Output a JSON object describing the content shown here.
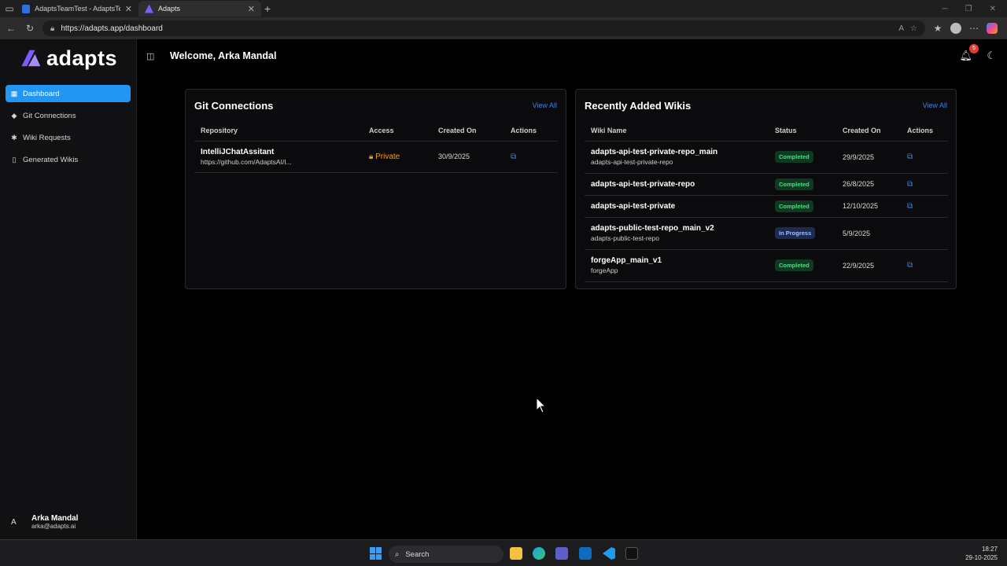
{
  "browser": {
    "tabs": [
      {
        "label": "AdaptsTeamTest - AdaptsTeamTe",
        "color": "#2f6fe4"
      },
      {
        "label": "Adapts",
        "color": "#7c5cff"
      }
    ],
    "url": "https://adapts.app/dashboard"
  },
  "app": {
    "logo_text": "adapts",
    "welcome": "Welcome, Arka Mandal",
    "notification_count": "5"
  },
  "sidebar": {
    "items": [
      {
        "label": "Dashboard",
        "icon": "grid-icon"
      },
      {
        "label": "Git Connections",
        "icon": "git-icon"
      },
      {
        "label": "Wiki Requests",
        "icon": "network-icon"
      },
      {
        "label": "Generated Wikis",
        "icon": "book-icon"
      }
    ],
    "user": {
      "avatar": "A",
      "name": "Arka Mandal",
      "email": "arka@adapts.ai"
    }
  },
  "git": {
    "title": "Git Connections",
    "view_all": "View All",
    "headers": [
      "Repository",
      "Access",
      "Created On",
      "Actions"
    ],
    "rows": [
      {
        "name": "IntelliJChatAssitant",
        "url": "https://github.com/AdaptsAI/I...",
        "access": "Private",
        "created": "30/9/2025"
      }
    ]
  },
  "wikis": {
    "title": "Recently Added Wikis",
    "view_all": "View All",
    "headers": [
      "Wiki Name",
      "Status",
      "Created On",
      "Actions"
    ],
    "rows": [
      {
        "name": "adapts-api-test-private-repo_main",
        "sub": "adapts-api-test-private-repo",
        "status": "Completed",
        "created": "29/9/2025",
        "has_link": true
      },
      {
        "name": "adapts-api-test-private-repo",
        "sub": "",
        "status": "Completed",
        "created": "26/8/2025",
        "has_link": true
      },
      {
        "name": "adapts-api-test-private",
        "sub": "",
        "status": "Completed",
        "created": "12/10/2025",
        "has_link": true
      },
      {
        "name": "adapts-public-test-repo_main_v2",
        "sub": "adapts-public-test-repo",
        "status": "In Progress",
        "created": "5/9/2025",
        "has_link": false
      },
      {
        "name": "forgeApp_main_v1",
        "sub": "forgeApp",
        "status": "Completed",
        "created": "22/9/2025",
        "has_link": true
      }
    ],
    "status_colors": {
      "Completed": "#4ade80",
      "In Progress": "#93c5fd"
    },
    "status_bg": {
      "Completed": "#0f3a22",
      "In Progress": "#1e2a55"
    }
  },
  "taskbar": {
    "search": "Search",
    "time": "18:27",
    "date": "29-10-2025"
  }
}
